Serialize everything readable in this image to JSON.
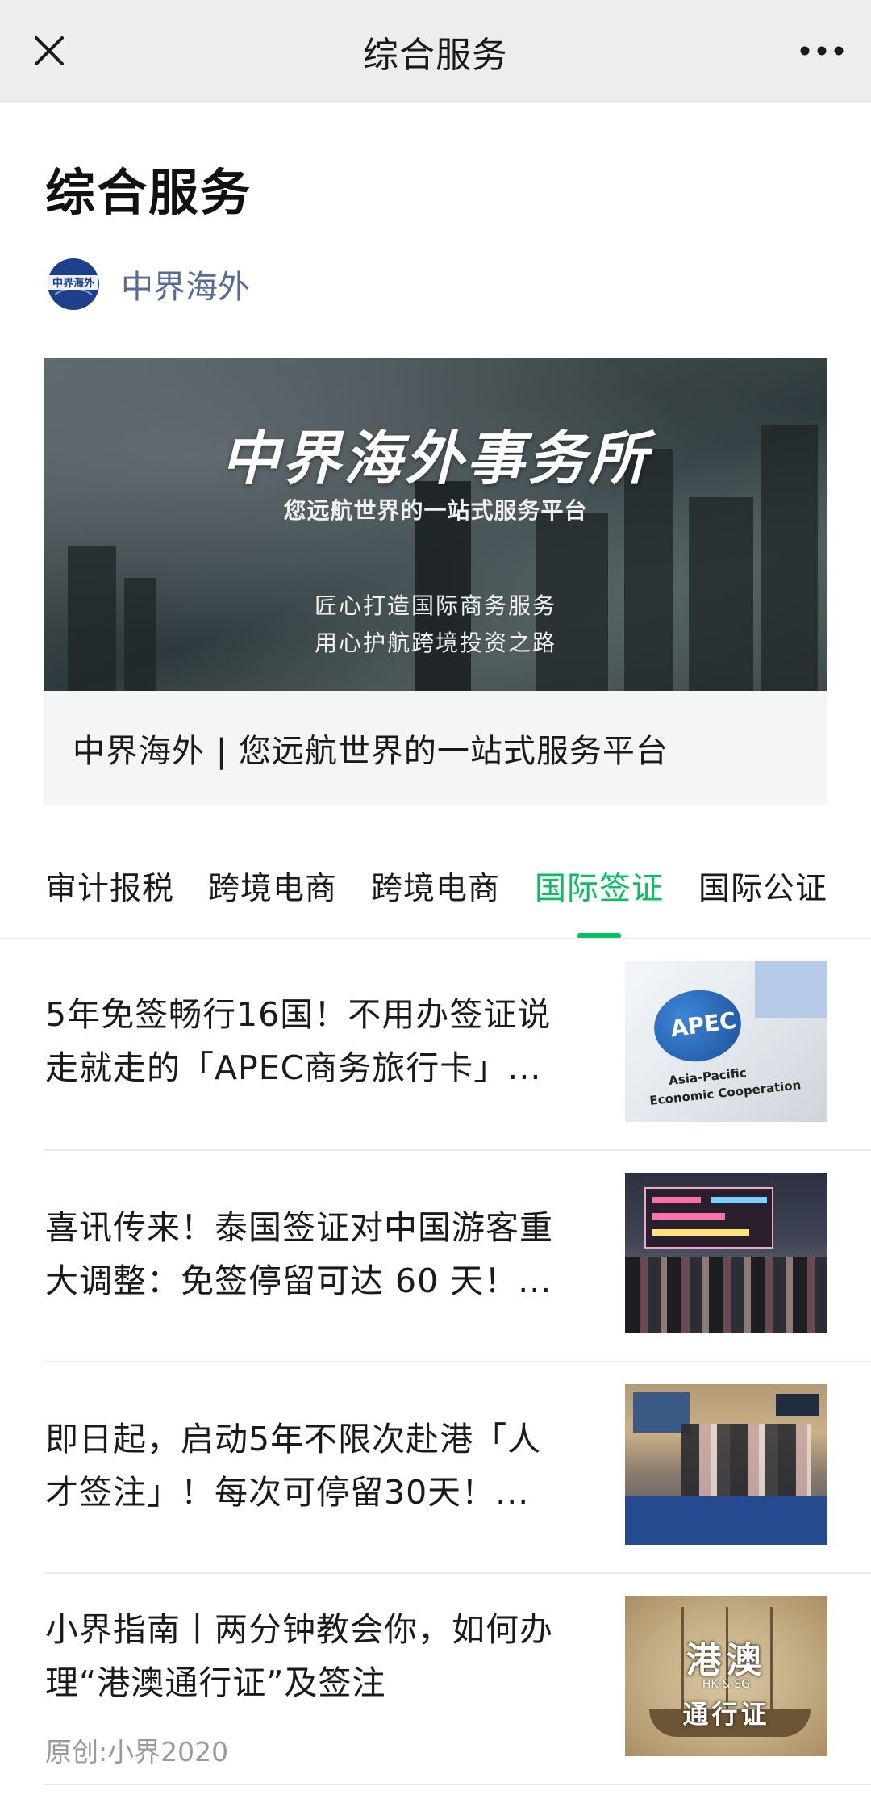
{
  "topbar": {
    "title": "综合服务"
  },
  "page": {
    "title": "综合服务"
  },
  "author": {
    "name": "中界海外",
    "logo_text": "中界海外"
  },
  "featured": {
    "banner_headline": "中界海外事务所",
    "banner_subtitle": "您远航世界的一站式服务平台",
    "banner_line1": "匠心打造国际商务服务",
    "banner_line2": "用心护航跨境投资之路",
    "caption": "中界海外 | 您远航世界的一站式服务平台"
  },
  "tabs": [
    {
      "label": "审计报税",
      "active": false
    },
    {
      "label": "跨境电商",
      "active": false
    },
    {
      "label": "跨境电商",
      "active": false
    },
    {
      "label": "国际签证",
      "active": true
    },
    {
      "label": "国际公证",
      "active": false
    }
  ],
  "articles": [
    {
      "line1": "5年免签畅行16国！不用办签证说",
      "line2": "走就走的「APEC商务旅行卡」...",
      "meta": "",
      "thumb": {
        "apec": "APEC",
        "line1": "Asia-Pacific",
        "line2": "Economic Cooperation"
      }
    },
    {
      "line1": "喜讯传来！泰国签证对中国游客重",
      "line2": "大调整：免签停留可达 60 天！...",
      "meta": ""
    },
    {
      "line1": "即日起，启动5年不限次赴港「人",
      "line2": "才签注」！每次可停留30天！...",
      "meta": ""
    },
    {
      "line1": "小界指南丨两分钟教会你，如何办",
      "line2": "理“港澳通行证”及签注",
      "meta": "原创:小界2020",
      "thumb": {
        "title": "港澳",
        "small": "HK & SG",
        "subtitle": "通行证"
      }
    }
  ],
  "colors": {
    "accent": "#07c160",
    "link": "#576b95",
    "topbar_bg": "#ededed"
  }
}
